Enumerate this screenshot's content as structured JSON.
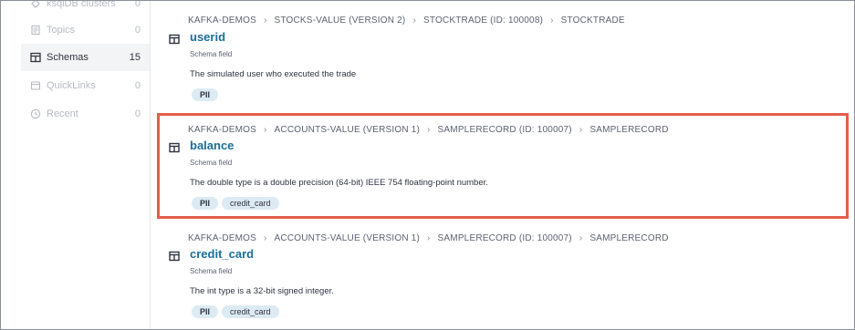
{
  "sidebar": {
    "items": [
      {
        "label": "ksqlDB clusters",
        "count": "0",
        "icon": "ksqldb-icon",
        "active": false
      },
      {
        "label": "Topics",
        "count": "0",
        "icon": "topics-icon",
        "active": false
      },
      {
        "label": "Schemas",
        "count": "15",
        "icon": "schemas-icon",
        "active": true
      },
      {
        "label": "QuickLinks",
        "count": "0",
        "icon": "quicklinks-icon",
        "active": false
      },
      {
        "label": "Recent",
        "count": "0",
        "icon": "clock-icon",
        "active": false
      }
    ]
  },
  "results": [
    {
      "breadcrumb": [
        "KAFKA-DEMOS",
        "STOCKS-VALUE (VERSION 2)",
        "STOCKTRADE (ID: 100008)",
        "STOCKTRADE"
      ],
      "name": "userid",
      "type": "Schema field",
      "description": "The simulated user who executed the trade",
      "tags": [
        "PII"
      ]
    },
    {
      "breadcrumb": [
        "KAFKA-DEMOS",
        "ACCOUNTS-VALUE (VERSION 1)",
        "SAMPLERECORD (ID: 100007)",
        "SAMPLERECORD"
      ],
      "name": "balance",
      "type": "Schema field",
      "description": "The double type is a double precision (64-bit) IEEE 754 floating-point number.",
      "tags": [
        "PII",
        "credit_card"
      ]
    },
    {
      "breadcrumb": [
        "KAFKA-DEMOS",
        "ACCOUNTS-VALUE (VERSION 1)",
        "SAMPLERECORD (ID: 100007)",
        "SAMPLERECORD"
      ],
      "name": "credit_card",
      "type": "Schema field",
      "description": "The int type is a 32-bit signed integer.",
      "tags": [
        "PII",
        "credit_card"
      ]
    }
  ],
  "colors": {
    "highlight": "#e35e4a",
    "link": "#1b6f99",
    "tag_bg": "#dceaf3"
  }
}
